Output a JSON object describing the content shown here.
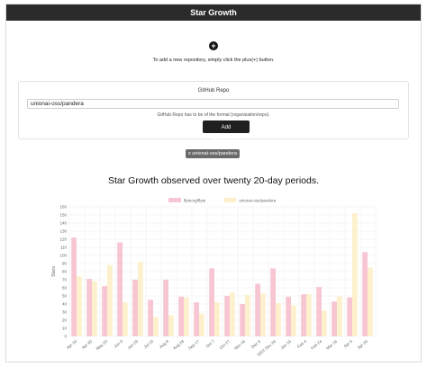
{
  "header": {
    "title": "Star Growth"
  },
  "add_section": {
    "plus_icon": "plus-circle-icon",
    "hint": "To add a new repository, simply click the plus(+) button."
  },
  "repo_form": {
    "label": "GitHub Repo",
    "value": "unionai-oss/pandera",
    "help": "GitHub Repo has to be of the format {organization/repo}.",
    "button": "Add Repository"
  },
  "chips": [
    {
      "label": "x unionai-oss/pandera"
    }
  ],
  "chart_data": {
    "type": "bar",
    "title": "Star Growth observed over twenty 20-day periods.",
    "ylabel": "Stars",
    "xlabel": "",
    "ylim": [
      0,
      160
    ],
    "yticks": [
      0,
      10,
      20,
      30,
      40,
      50,
      60,
      70,
      80,
      90,
      100,
      110,
      120,
      130,
      140,
      150,
      160
    ],
    "categories": [
      "Apr 10",
      "Apr 30",
      "May 20",
      "Jun 9",
      "Jun 29",
      "Jul 19",
      "Aug 8",
      "Aug 28",
      "Sep 17",
      "Oct 7",
      "Oct 27",
      "Nov 16",
      "Dec 6",
      "2022 Dec 26",
      "Jan 15",
      "Feb 4",
      "Feb 24",
      "Mar 16",
      "Apr 5",
      "Apr 25"
    ],
    "series": [
      {
        "name": "flyteorg/flyte",
        "color": "#f7c6d2",
        "values": [
          122,
          71,
          62,
          116,
          70,
          45,
          70,
          49,
          42,
          84,
          50,
          40,
          65,
          84,
          49,
          52,
          61,
          43,
          48,
          104
        ]
      },
      {
        "name": "unionai-oss/pandera",
        "color": "#fdf0cc",
        "values": [
          74,
          68,
          88,
          42,
          92,
          24,
          26,
          48,
          28,
          42,
          54,
          51,
          53,
          41,
          38,
          52,
          32,
          49,
          152,
          85
        ]
      }
    ],
    "legend": "top-center",
    "grid": true
  }
}
